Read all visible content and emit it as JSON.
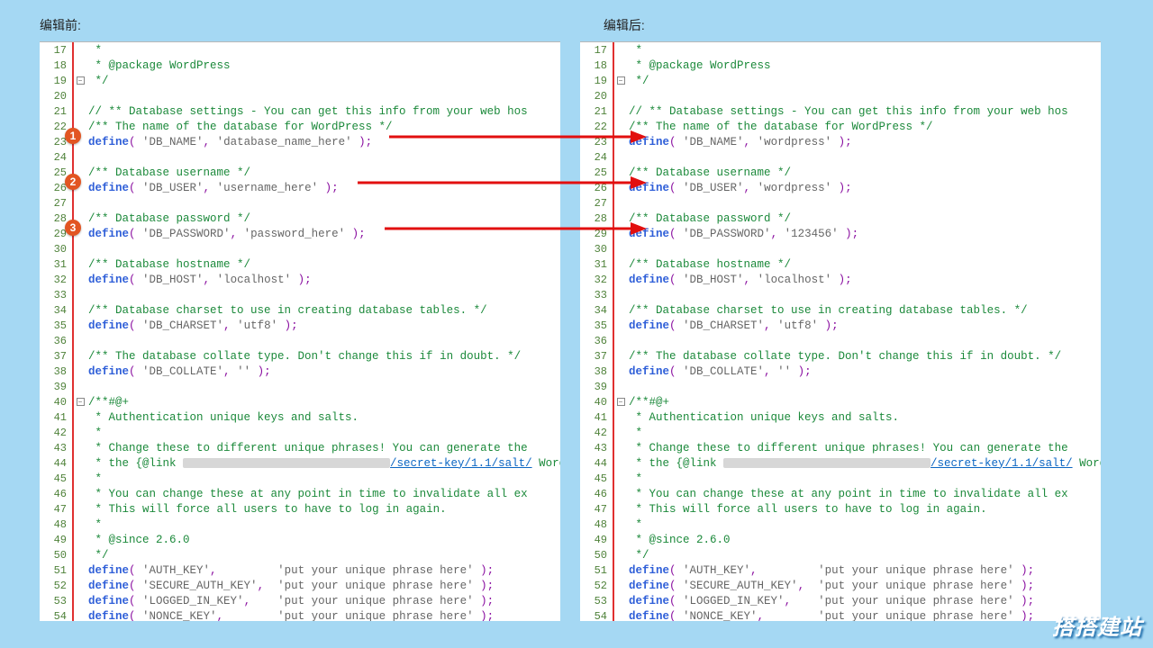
{
  "labels": {
    "before": "编辑前:",
    "after": "编辑后:"
  },
  "badges": {
    "b1": "1",
    "b2": "2",
    "b3": "3"
  },
  "watermark": "搭搭建站",
  "lines": [
    {
      "n": 17,
      "tokens": [
        " ",
        {
          "cls": "cm",
          "t": "*"
        }
      ]
    },
    {
      "n": 18,
      "tokens": [
        " ",
        {
          "cls": "cm",
          "t": "* @package WordPress"
        }
      ]
    },
    {
      "n": 19,
      "fold": "-",
      "tokens": [
        " ",
        {
          "cls": "cm",
          "t": "*/"
        }
      ]
    },
    {
      "n": 20,
      "tokens": []
    },
    {
      "n": 21,
      "tokens": [
        {
          "cls": "cm",
          "t": "// ** Database settings - You can get this info from your web hos"
        }
      ]
    },
    {
      "n": 22,
      "tokens": [
        {
          "cls": "cm",
          "t": "/** The name of the database for WordPress */"
        }
      ]
    },
    {
      "n": 23,
      "tokens": [
        {
          "cls": "kw",
          "t": "define"
        },
        {
          "cls": "op",
          "t": "( "
        },
        {
          "cls": "str",
          "t": "'DB_NAME'"
        },
        {
          "cls": "op",
          "t": ", "
        },
        {
          "cls": "str_val",
          "vkey": "db_name"
        },
        {
          "cls": "op",
          "t": " )"
        },
        {
          "cls": "op",
          "t": ";"
        }
      ]
    },
    {
      "n": 24,
      "tokens": []
    },
    {
      "n": 25,
      "tokens": [
        {
          "cls": "cm",
          "t": "/** Database username */"
        }
      ]
    },
    {
      "n": 26,
      "tokens": [
        {
          "cls": "kw",
          "t": "define"
        },
        {
          "cls": "op",
          "t": "( "
        },
        {
          "cls": "str",
          "t": "'DB_USER'"
        },
        {
          "cls": "op",
          "t": ", "
        },
        {
          "cls": "str_val",
          "vkey": "db_user"
        },
        {
          "cls": "op",
          "t": " )"
        },
        {
          "cls": "op",
          "t": ";"
        }
      ]
    },
    {
      "n": 27,
      "tokens": []
    },
    {
      "n": 28,
      "tokens": [
        {
          "cls": "cm",
          "t": "/** Database password */"
        }
      ]
    },
    {
      "n": 29,
      "tokens": [
        {
          "cls": "kw",
          "t": "define"
        },
        {
          "cls": "op",
          "t": "( "
        },
        {
          "cls": "str",
          "t": "'DB_PASSWORD'"
        },
        {
          "cls": "op",
          "t": ", "
        },
        {
          "cls": "str_val",
          "vkey": "db_password"
        },
        {
          "cls": "op",
          "t": " )"
        },
        {
          "cls": "op",
          "t": ";"
        }
      ]
    },
    {
      "n": 30,
      "tokens": []
    },
    {
      "n": 31,
      "tokens": [
        {
          "cls": "cm",
          "t": "/** Database hostname */"
        }
      ]
    },
    {
      "n": 32,
      "tokens": [
        {
          "cls": "kw",
          "t": "define"
        },
        {
          "cls": "op",
          "t": "( "
        },
        {
          "cls": "str",
          "t": "'DB_HOST'"
        },
        {
          "cls": "op",
          "t": ", "
        },
        {
          "cls": "str",
          "t": "'localhost'"
        },
        {
          "cls": "op",
          "t": " )"
        },
        {
          "cls": "op",
          "t": ";"
        }
      ]
    },
    {
      "n": 33,
      "tokens": []
    },
    {
      "n": 34,
      "tokens": [
        {
          "cls": "cm",
          "t": "/** Database charset to use in creating database tables. */"
        }
      ]
    },
    {
      "n": 35,
      "tokens": [
        {
          "cls": "kw",
          "t": "define"
        },
        {
          "cls": "op",
          "t": "( "
        },
        {
          "cls": "str",
          "t": "'DB_CHARSET'"
        },
        {
          "cls": "op",
          "t": ", "
        },
        {
          "cls": "str",
          "t": "'utf8'"
        },
        {
          "cls": "op",
          "t": " )"
        },
        {
          "cls": "op",
          "t": ";"
        }
      ]
    },
    {
      "n": 36,
      "tokens": []
    },
    {
      "n": 37,
      "tokens": [
        {
          "cls": "cm",
          "t": "/** The database collate type. Don't change this if in doubt. */"
        }
      ]
    },
    {
      "n": 38,
      "tokens": [
        {
          "cls": "kw",
          "t": "define"
        },
        {
          "cls": "op",
          "t": "( "
        },
        {
          "cls": "str",
          "t": "'DB_COLLATE'"
        },
        {
          "cls": "op",
          "t": ", "
        },
        {
          "cls": "str",
          "t": "''"
        },
        {
          "cls": "op",
          "t": " )"
        },
        {
          "cls": "op",
          "t": ";"
        }
      ]
    },
    {
      "n": 39,
      "tokens": []
    },
    {
      "n": 40,
      "fold": "-",
      "tokens": [
        {
          "cls": "cm",
          "t": "/**#@+"
        }
      ]
    },
    {
      "n": 41,
      "tokens": [
        " ",
        {
          "cls": "cm",
          "t": "* Authentication unique keys and salts."
        }
      ]
    },
    {
      "n": 42,
      "tokens": [
        " ",
        {
          "cls": "cm",
          "t": "*"
        }
      ]
    },
    {
      "n": 43,
      "tokens": [
        " ",
        {
          "cls": "cm",
          "t": "* Change these to different unique phrases! You can generate the"
        }
      ]
    },
    {
      "n": 44,
      "linkline": true,
      "tokens": [
        " ",
        {
          "cls": "cm",
          "t": "* the {@link "
        },
        {
          "cls": "redact"
        },
        {
          "cls": "lnk",
          "t": "/secret-key/1.1/salt/"
        },
        {
          "cls": "cm",
          "t": " Word"
        }
      ]
    },
    {
      "n": 45,
      "tokens": [
        " ",
        {
          "cls": "cm",
          "t": "*"
        }
      ]
    },
    {
      "n": 46,
      "tokens": [
        " ",
        {
          "cls": "cm",
          "t": "* You can change these at any point in time to invalidate all ex"
        }
      ]
    },
    {
      "n": 47,
      "tokens": [
        " ",
        {
          "cls": "cm",
          "t": "* This will force all users to have to log in again."
        }
      ]
    },
    {
      "n": 48,
      "tokens": [
        " ",
        {
          "cls": "cm",
          "t": "*"
        }
      ]
    },
    {
      "n": 49,
      "tokens": [
        " ",
        {
          "cls": "cm",
          "t": "* @since 2.6.0"
        }
      ]
    },
    {
      "n": 50,
      "tokens": [
        " ",
        {
          "cls": "cm",
          "t": "*/"
        }
      ]
    },
    {
      "n": 51,
      "tokens": [
        {
          "cls": "kw",
          "t": "define"
        },
        {
          "cls": "op",
          "t": "( "
        },
        {
          "cls": "str",
          "t": "'AUTH_KEY'"
        },
        {
          "cls": "op",
          "t": ",         "
        },
        {
          "cls": "str",
          "t": "'put your unique phrase here'"
        },
        {
          "cls": "op",
          "t": " )"
        },
        {
          "cls": "op",
          "t": ";"
        }
      ]
    },
    {
      "n": 52,
      "tokens": [
        {
          "cls": "kw",
          "t": "define"
        },
        {
          "cls": "op",
          "t": "( "
        },
        {
          "cls": "str",
          "t": "'SECURE_AUTH_KEY'"
        },
        {
          "cls": "op",
          "t": ",  "
        },
        {
          "cls": "str",
          "t": "'put your unique phrase here'"
        },
        {
          "cls": "op",
          "t": " )"
        },
        {
          "cls": "op",
          "t": ";"
        }
      ]
    },
    {
      "n": 53,
      "tokens": [
        {
          "cls": "kw",
          "t": "define"
        },
        {
          "cls": "op",
          "t": "( "
        },
        {
          "cls": "str",
          "t": "'LOGGED_IN_KEY'"
        },
        {
          "cls": "op",
          "t": ",    "
        },
        {
          "cls": "str",
          "t": "'put your unique phrase here'"
        },
        {
          "cls": "op",
          "t": " )"
        },
        {
          "cls": "op",
          "t": ";"
        }
      ]
    },
    {
      "n": 54,
      "tokens": [
        {
          "cls": "kw",
          "t": "define"
        },
        {
          "cls": "op",
          "t": "( "
        },
        {
          "cls": "str",
          "t": "'NONCE_KEY'"
        },
        {
          "cls": "op",
          "t": ",        "
        },
        {
          "cls": "str",
          "t": "'put your unique phrase here'"
        },
        {
          "cls": "op",
          "t": " )"
        },
        {
          "cls": "op",
          "t": ";"
        }
      ]
    }
  ],
  "vals_before": {
    "db_name": "'database_name_here'",
    "db_user": "'username_here'",
    "db_password": "'password_here'"
  },
  "vals_after": {
    "db_name": "'wordpress'",
    "db_user": "'wordpress'",
    "db_password": "'123456'"
  }
}
